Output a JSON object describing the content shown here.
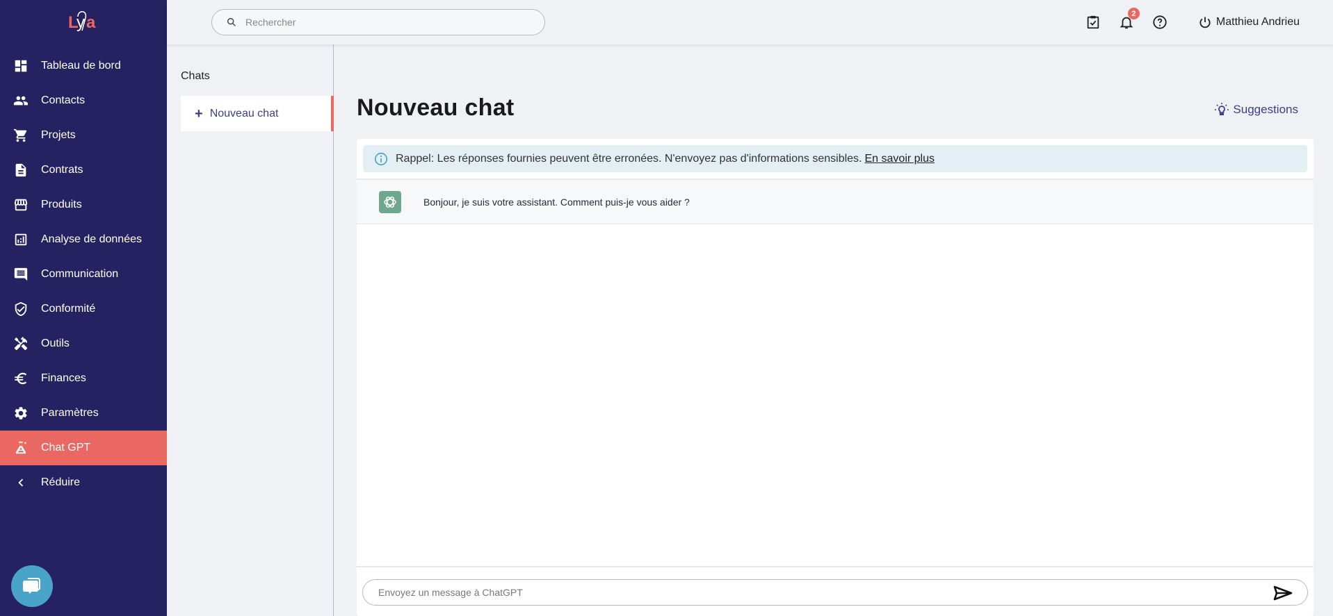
{
  "brand": {
    "logo_text": "Lya",
    "accent": "#e96962",
    "sidebar_bg": "#262262"
  },
  "sidebar": {
    "items": [
      {
        "label": "Tableau de bord",
        "icon": "dashboard-icon"
      },
      {
        "label": "Contacts",
        "icon": "people-icon"
      },
      {
        "label": "Projets",
        "icon": "cart-icon"
      },
      {
        "label": "Contrats",
        "icon": "document-icon"
      },
      {
        "label": "Produits",
        "icon": "storefront-icon"
      },
      {
        "label": "Analyse de données",
        "icon": "bar-chart-icon"
      },
      {
        "label": "Communication",
        "icon": "message-icon"
      },
      {
        "label": "Conformité",
        "icon": "shield-check-icon"
      },
      {
        "label": "Outils",
        "icon": "tools-icon"
      },
      {
        "label": "Finances",
        "icon": "euro-icon"
      },
      {
        "label": "Paramètres",
        "icon": "gear-icon"
      },
      {
        "label": "Chat GPT",
        "icon": "flask-sparkle-icon",
        "active": true
      },
      {
        "label": "Réduire",
        "icon": "chevron-left-icon"
      }
    ]
  },
  "topbar": {
    "search_placeholder": "Rechercher",
    "notifications_count": "2",
    "user_name": "Matthieu Andrieu"
  },
  "chats": {
    "title": "Chats",
    "new_chat_label": "Nouveau chat"
  },
  "main": {
    "title": "Nouveau chat",
    "suggestions_label": "Suggestions",
    "alert_text": "Rappel: Les réponses fournies peuvent être erronées. N'envoyez pas d'informations sensibles.",
    "alert_link": "En savoir plus",
    "messages": [
      {
        "role": "assistant",
        "text": "Bonjour, je suis votre assistant. Comment puis-je vous aider ?"
      }
    ],
    "composer_placeholder": "Envoyez un message à ChatGPT"
  }
}
